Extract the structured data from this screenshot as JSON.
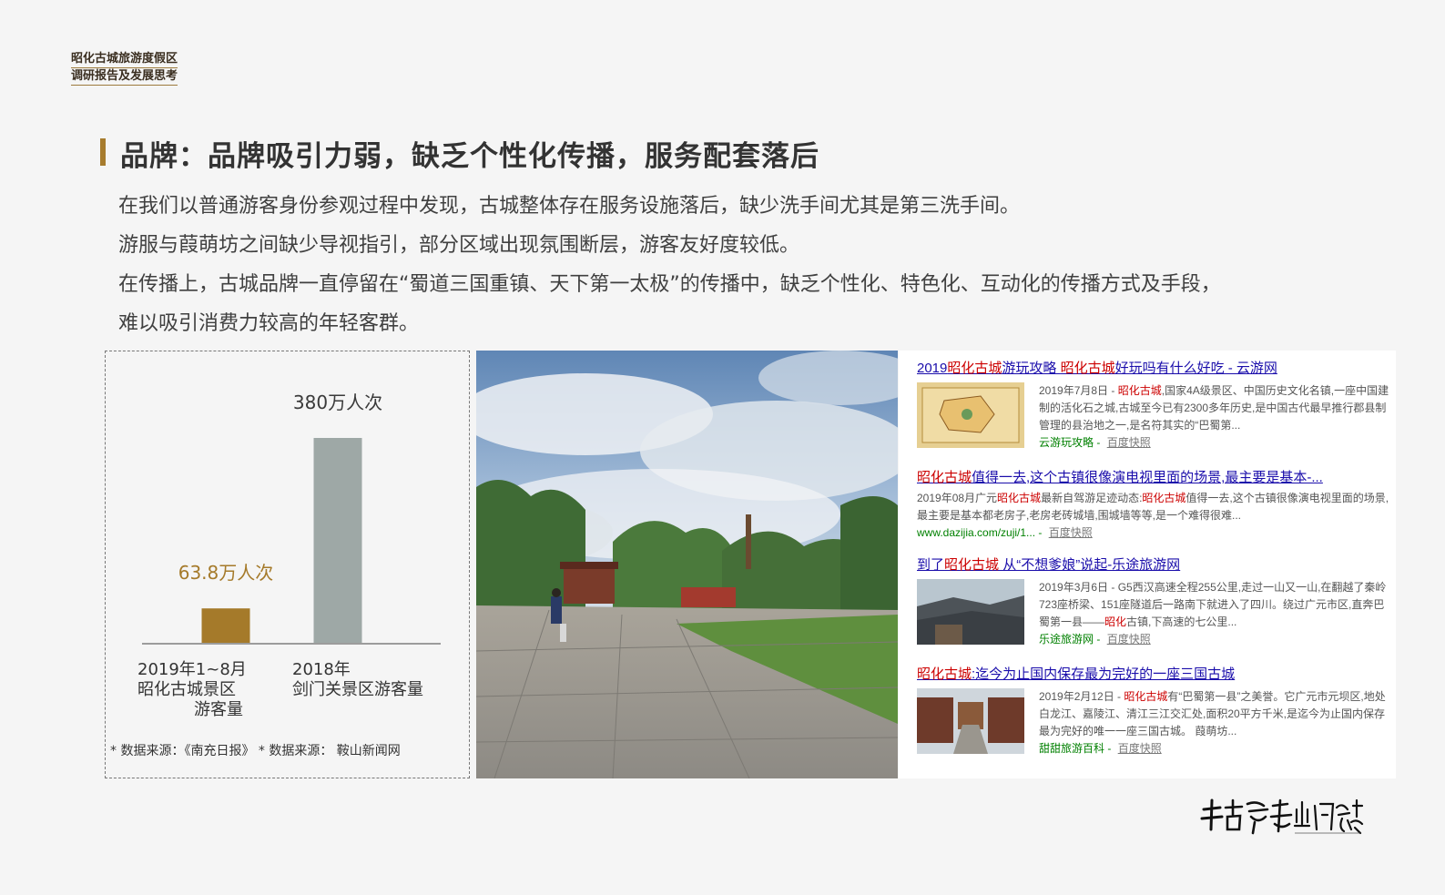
{
  "header": {
    "line1": "昭化古城旅游度假区",
    "line2": "调研报告及发展思考"
  },
  "title": "品牌：品牌吸引力弱，缺乏个性化传播，服务配套落后",
  "paragraphs": [
    "在我们以普通游客身份参观过程中发现，古城整体存在服务设施落后，缺少洗手间尤其是第三洗手间。",
    "游服与葭萌坊之间缺少导视指引，部分区域出现氛围断层，游客友好度较低。",
    "在传播上，古城品牌一直停留在“蜀道三国重镇、天下第一太极”的传播中，缺乏个性化、特色化、互动化的传播方式及手段，",
    "难以吸引消费力较高的年轻客群。"
  ],
  "chart_data": {
    "type": "bar",
    "categories": [
      "2019年1~8月 昭化古城景区 游客量",
      "2018年 剑门关景区游客量"
    ],
    "category_lines": [
      [
        "2019年1~8月",
        "昭化古城景区",
        "游客量"
      ],
      [
        "2018年",
        "剑门关景区游客量"
      ]
    ],
    "values": [
      63.8,
      380
    ],
    "value_labels": [
      "63.8万人次",
      "380万人次"
    ],
    "colors": [
      "#a57a2a",
      "#9ea8a6"
    ],
    "label_colors": [
      "#a57a2a",
      "#3a3a3a"
    ],
    "unit": "万人次"
  },
  "source_note": "* 数据来源：《南充日报》 * 数据来源： 鞍山新闻网",
  "search_results": [
    {
      "title_parts": [
        [
          "2019",
          ""
        ],
        [
          "昭化古城",
          "hl"
        ],
        [
          "游玩攻略 ",
          ""
        ],
        [
          "昭化古城",
          "hl"
        ],
        [
          "好玩吗有什么好吃 - 云游网",
          ""
        ]
      ],
      "date": "2019年7月8日 - ",
      "text_parts": [
        [
          "昭化古城",
          "hl"
        ],
        [
          ",国家4A级景区、中国历史文化名镇,一座中国建制的活化石之城,古城至今已有2300多年历史,是中国古代最早推行郡县制管理的县治地之一,是名符其实的“巴蜀第...",
          ""
        ]
      ],
      "source": "云游玩攻略",
      "snapshot": "百度快照",
      "has_thumb": true
    },
    {
      "title_parts": [
        [
          "昭化古城",
          "hl"
        ],
        [
          "值得一去,这个古镇很像演电视里面的场景,最主要是基本-...",
          ""
        ]
      ],
      "date": "2019年08月广元",
      "text_parts": [
        [
          "昭化古城",
          "hl"
        ],
        [
          "最新自驾游足迹动态:",
          ""
        ],
        [
          "昭化古城",
          "hl"
        ],
        [
          "值得一去,这个古镇很像演电视里面的场景,最主要是基本都老房子,老房老砖城墙,围城墙等等,是一个难得很难...",
          ""
        ]
      ],
      "source": "www.dazijia.com/zuji/1...",
      "snapshot": "百度快照",
      "has_thumb": false
    },
    {
      "title_parts": [
        [
          "到了",
          ""
        ],
        [
          "昭化古城",
          "hl"
        ],
        [
          " 从“不想爹娘”说起-乐途旅游网",
          ""
        ]
      ],
      "date": "2019年3月6日 - ",
      "text_parts": [
        [
          "G5西汉高速全程255公里,走过一山又一山,在翻越了秦岭723座桥梁、151座隧道后一路南下就进入了四川。绕过广元市区,直奔巴蜀第一县——",
          ""
        ],
        [
          "昭化",
          "hl"
        ],
        [
          "古镇,下高速的七公里...",
          ""
        ]
      ],
      "source": "乐途旅游网",
      "snapshot": "百度快照",
      "has_thumb": true
    },
    {
      "title_parts": [
        [
          "昭化古城",
          "hl"
        ],
        [
          ":迄今为止国内保存最为完好的一座三国古城",
          ""
        ]
      ],
      "date": "2019年2月12日 - ",
      "text_parts": [
        [
          "昭化古城",
          "hl"
        ],
        [
          "有“巴蜀第一县”之美誉。它广元市元坝区,地处白龙江、嘉陵江、清江三江交汇处,面积20平方千米,是迄今为止国内保存最为完好的唯一一座三国古城。 葭萌坊...",
          ""
        ]
      ],
      "source": "甜甜旅游百科",
      "snapshot": "百度快照",
      "has_thumb": true
    }
  ],
  "logo_text": "千古繁华山河秘藏"
}
